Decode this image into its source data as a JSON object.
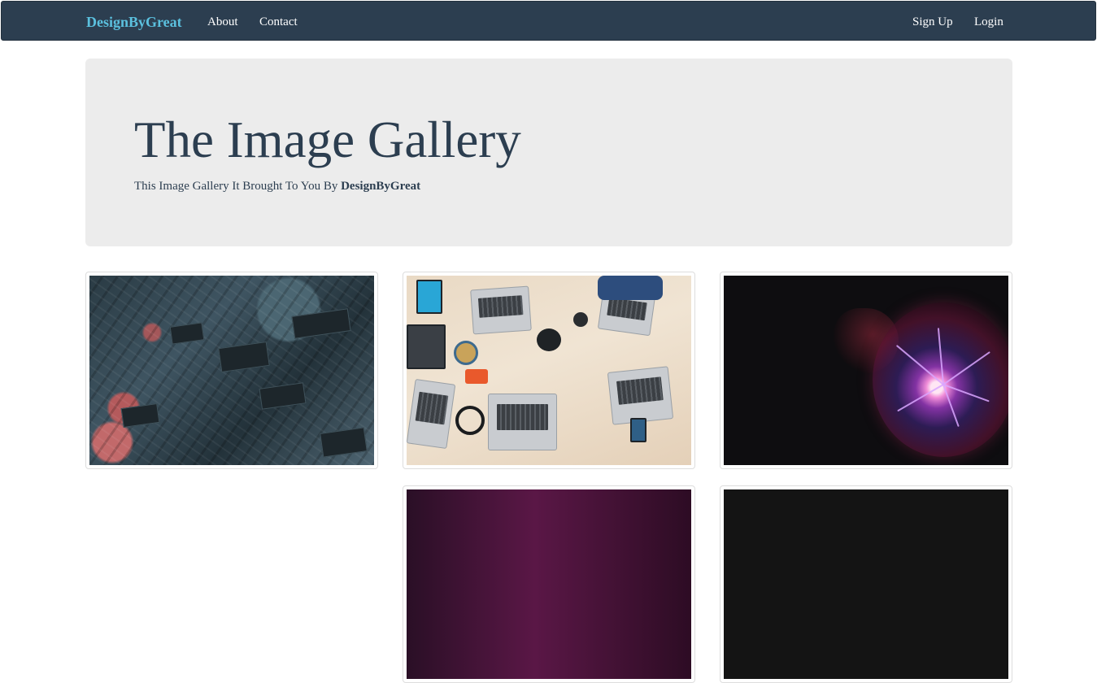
{
  "navbar": {
    "brand": "DesignByGreat",
    "links": [
      {
        "label": "About"
      },
      {
        "label": "Contact"
      }
    ],
    "right_links": [
      {
        "label": "Sign Up"
      },
      {
        "label": "Login"
      }
    ],
    "colors": {
      "background": "#2c3e50",
      "brand": "#5bc0de",
      "link": "#ffffff"
    }
  },
  "jumbotron": {
    "title": "The Image Gallery",
    "subtitle_prefix": "This Image Gallery It Brought To You By ",
    "subtitle_brand": "DesignByGreat",
    "colors": {
      "background": "#ececec",
      "text": "#2c3e50"
    }
  },
  "gallery": {
    "images": [
      {
        "subject": "circuit-board-photo"
      },
      {
        "subject": "desk-with-laptops-photo"
      },
      {
        "subject": "plasma-ball-photo"
      },
      {
        "subject": "dark-magenta-photo"
      },
      {
        "subject": "dark-photo"
      }
    ]
  }
}
